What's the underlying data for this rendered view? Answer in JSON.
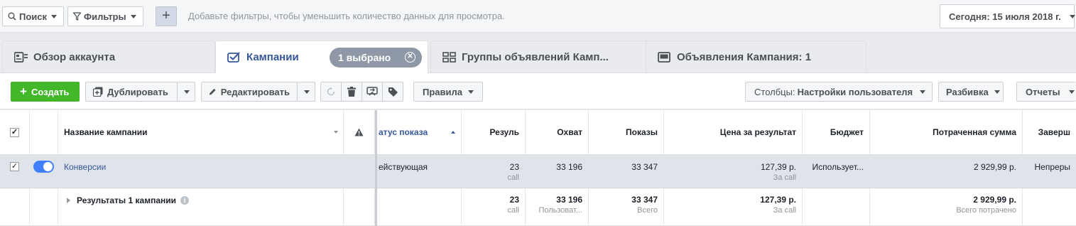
{
  "filter_bar": {
    "search_label": "Поиск",
    "filters_label": "Фильтры",
    "add_label": "+",
    "hint": "Добавьте фильтры, чтобы уменьшить количество данных для просмотра.",
    "date_label": "Сегодня: 15 июля 2018 г."
  },
  "tabs": [
    {
      "label": "Обзор аккаунта",
      "icon": "account-overview-icon"
    },
    {
      "label": "Кампании",
      "icon": "campaigns-icon",
      "active": true
    },
    {
      "label": "Группы объявлений Камп...",
      "icon": "ad-sets-icon"
    },
    {
      "label": "Объявления Кампания: 1",
      "icon": "ads-icon"
    }
  ],
  "selected_pill": "1 выбрано",
  "toolbar": {
    "create": "Создать",
    "duplicate": "Дублировать",
    "edit": "Редактировать",
    "rules": "Правила",
    "columns_prefix": "Столбцы:",
    "columns_value": "Настройки пользователя",
    "breakdown": "Разбивка",
    "reports": "Отчеты"
  },
  "table": {
    "headers": {
      "name": "Название кампании",
      "delivery": "атус показа",
      "results": "Резуль",
      "reach": "Охват",
      "impressions": "Показы",
      "cost": "Цена за результат",
      "budget": "Бюджет",
      "spent": "Потраченная сумма",
      "ends": "Заверш"
    },
    "row": {
      "name": "Конверсии",
      "delivery": "ействующая",
      "results": "23",
      "results_sub": "call",
      "reach": "33 196",
      "impressions": "33 347",
      "cost": "127,39 р.",
      "cost_sub": "За call",
      "budget": "Использует...",
      "spent": "2 929,99 р.",
      "ends": "Непреры"
    },
    "totals": {
      "label": "Результаты 1 кампании",
      "results": "23",
      "results_sub": "call",
      "reach": "33 196",
      "reach_sub": "Пользоват...",
      "impressions": "33 347",
      "impressions_sub": "Всего",
      "cost": "127,39 р.",
      "cost_sub": "За call",
      "spent": "2 929,99 р.",
      "spent_sub": "Всего потрачено"
    }
  }
}
